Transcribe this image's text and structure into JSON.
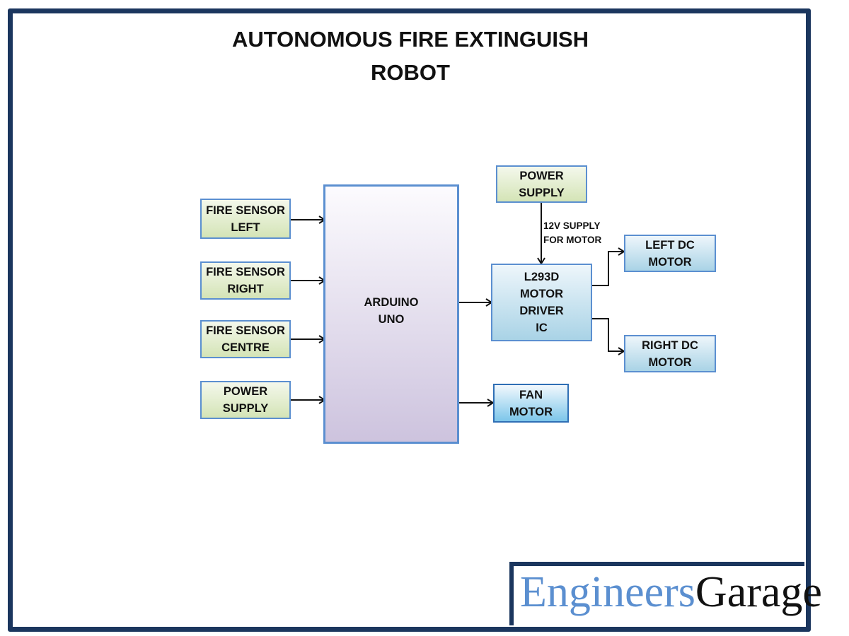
{
  "title": {
    "line1": "AUTONOMOUS FIRE EXTINGUISH",
    "line2": "ROBOT"
  },
  "blocks": {
    "fire_sensor_left": "FIRE SENSOR\nLEFT",
    "fire_sensor_right": "FIRE SENSOR\nRIGHT",
    "fire_sensor_centre": "FIRE SENSOR\nCENTRE",
    "power_supply_left": "POWER\nSUPPLY",
    "arduino": "ARDUINO\nUNO",
    "power_supply_top": "POWER\nSUPPLY",
    "motor_driver": "L293D\nMOTOR\nDRIVER\nIC",
    "left_dc_motor": "LEFT DC\nMOTOR",
    "right_dc_motor": "RIGHT DC\nMOTOR",
    "fan_motor": "FAN\nMOTOR"
  },
  "annotations": {
    "supply_note_line1": "12V SUPPLY",
    "supply_note_line2": "FOR MOTOR"
  },
  "connections": [
    {
      "from": "fire_sensor_left",
      "to": "arduino"
    },
    {
      "from": "fire_sensor_right",
      "to": "arduino"
    },
    {
      "from": "fire_sensor_centre",
      "to": "arduino"
    },
    {
      "from": "power_supply_left",
      "to": "arduino"
    },
    {
      "from": "arduino",
      "to": "motor_driver"
    },
    {
      "from": "arduino",
      "to": "fan_motor"
    },
    {
      "from": "power_supply_top",
      "to": "motor_driver",
      "label": "12V SUPPLY FOR MOTOR"
    },
    {
      "from": "motor_driver",
      "to": "left_dc_motor"
    },
    {
      "from": "motor_driver",
      "to": "right_dc_motor"
    }
  ],
  "logo": {
    "part1": "Engineers",
    "part2": "Garage"
  },
  "colors": {
    "frame": "#1b365e",
    "box_border": "#5b8fd0",
    "logo_blue": "#5b8fd0"
  }
}
